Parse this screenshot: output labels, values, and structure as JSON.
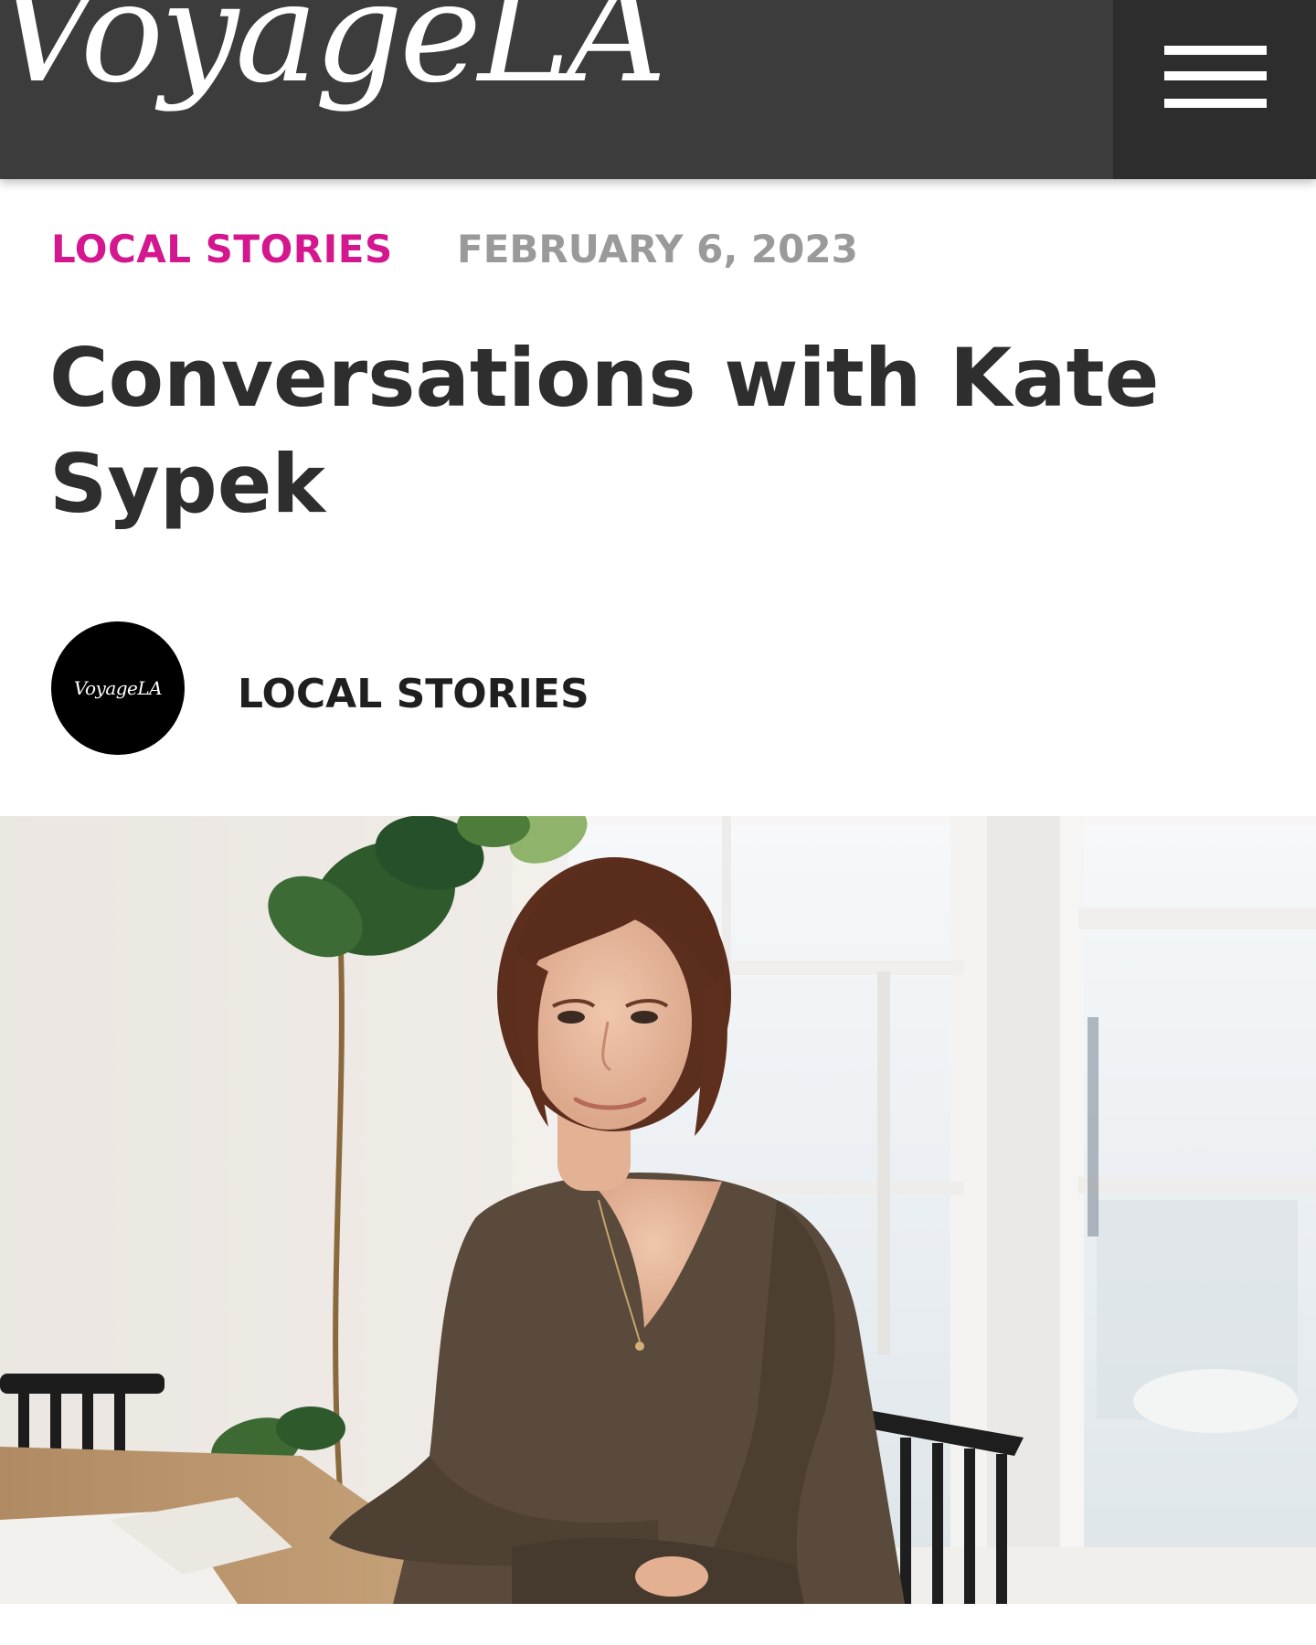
{
  "header": {
    "logo_text": "VoyageLA",
    "menu_icon": "hamburger-menu-icon"
  },
  "article": {
    "category": "LOCAL STORIES",
    "date": "FEBRUARY 6, 2023",
    "title": "Conversations with Kate Sypek",
    "author": {
      "avatar_text": "VoyageLA",
      "name": "LOCAL STORIES"
    }
  },
  "colors": {
    "header_bg": "#3c3c3c",
    "menu_bg": "#2d2d2d",
    "category_accent": "#d4178f",
    "date_gray": "#9a9a9a",
    "title_text": "#2e2e2e"
  }
}
